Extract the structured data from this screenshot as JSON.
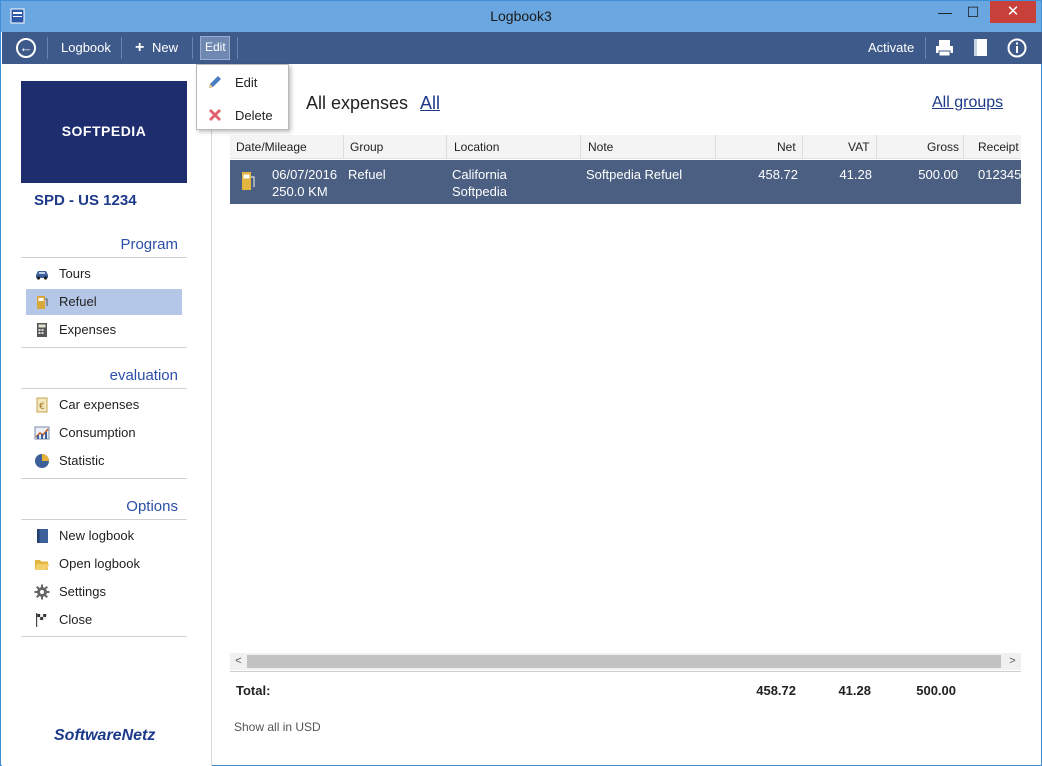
{
  "window": {
    "title": "Logbook3",
    "minimize": "—",
    "maximize": "☐",
    "close": "✕"
  },
  "toolbar": {
    "back_icon": "back-arrow-icon",
    "logbook_label": "Logbook",
    "new_label": "New",
    "edit_label": "Edit",
    "activate_label": "Activate",
    "icons": [
      "printer-icon",
      "book-icon",
      "info-icon"
    ]
  },
  "edit_menu": {
    "items": [
      {
        "label": "Edit",
        "icon": "pencil-icon"
      },
      {
        "label": "Delete",
        "icon": "delete-x-icon"
      }
    ]
  },
  "sidebar": {
    "logo_text": "SOFTPEDIA",
    "vehicle": "SPD - US 1234",
    "sections": [
      {
        "title": "Program",
        "items": [
          {
            "label": "Tours",
            "icon": "car-icon",
            "selected": false
          },
          {
            "label": "Refuel",
            "icon": "fuel-pump-icon",
            "selected": true
          },
          {
            "label": "Expenses",
            "icon": "calculator-icon",
            "selected": false
          }
        ]
      },
      {
        "title": "evaluation",
        "items": [
          {
            "label": "Car expenses",
            "icon": "euro-doc-icon",
            "selected": false
          },
          {
            "label": "Consumption",
            "icon": "bar-chart-icon",
            "selected": false
          },
          {
            "label": "Statistic",
            "icon": "pie-chart-icon",
            "selected": false
          }
        ]
      },
      {
        "title": "Options",
        "items": [
          {
            "label": "New logbook",
            "icon": "new-book-icon",
            "selected": false
          },
          {
            "label": "Open logbook",
            "icon": "folder-open-icon",
            "selected": false
          },
          {
            "label": "Settings",
            "icon": "gear-icon",
            "selected": false
          },
          {
            "label": "Close",
            "icon": "checkered-flag-icon",
            "selected": false
          }
        ]
      }
    ],
    "footer_brand": "SoftwareNetz"
  },
  "main": {
    "heading": "All expenses",
    "filter_link": "All",
    "groups_link": "All groups",
    "columns": [
      "Date/Mileage",
      "Group",
      "Location",
      "Note",
      "Net",
      "VAT",
      "Gross",
      "Receipt"
    ],
    "rows": [
      {
        "date": "06/07/2016",
        "mileage": "250.0 KM",
        "group": "Refuel",
        "location_line1": "California",
        "location_line2": "Softpedia",
        "note": "Softpedia Refuel",
        "net": "458.72",
        "vat": "41.28",
        "gross": "500.00",
        "receipt": "012345"
      }
    ],
    "totals": {
      "label": "Total:",
      "net": "458.72",
      "vat": "41.28",
      "gross": "500.00"
    },
    "show_currency": "Show all in USD",
    "scroll_left": "<",
    "scroll_right": ">"
  }
}
